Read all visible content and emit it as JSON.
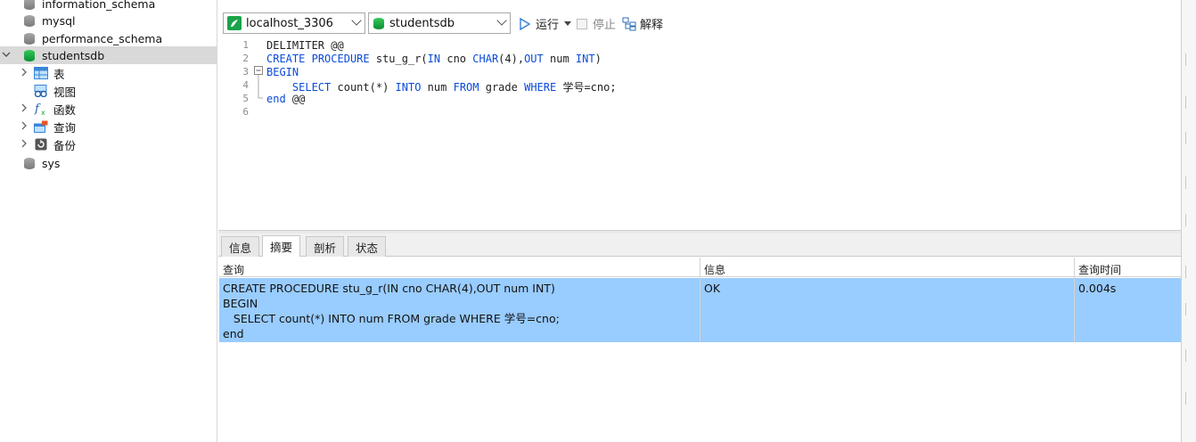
{
  "sidebar": {
    "items": [
      {
        "label": "information_schema"
      },
      {
        "label": "mysql"
      },
      {
        "label": "performance_schema"
      },
      {
        "label": "studentsdb"
      },
      {
        "label": "sys"
      }
    ],
    "children": [
      {
        "label": "表"
      },
      {
        "label": "视图"
      },
      {
        "label": "函数"
      },
      {
        "label": "查询"
      },
      {
        "label": "备份"
      }
    ]
  },
  "toolbar": {
    "connection": "localhost_3306",
    "database": "studentsdb",
    "run_label": "运行",
    "stop_label": "停止",
    "explain_label": "解释"
  },
  "editor": {
    "line_numbers": [
      "1",
      "2",
      "3",
      "4",
      "5",
      "6"
    ],
    "lines": [
      "DELIMITER @@",
      "CREATE PROCEDURE stu_g_r(IN cno CHAR(4),OUT num INT)",
      "BEGIN",
      "    SELECT count(*) INTO num FROM grade WHERE 学号=cno;",
      "end @@",
      ""
    ]
  },
  "result_tabs": [
    {
      "label": "信息"
    },
    {
      "label": "摘要"
    },
    {
      "label": "剖析"
    },
    {
      "label": "状态"
    }
  ],
  "result_grid": {
    "headers": [
      "查询",
      "信息",
      "查询时间"
    ],
    "row": {
      "query": "CREATE PROCEDURE stu_g_r(IN cno CHAR(4),OUT num INT)\nBEGIN\n   SELECT count(*) INTO num FROM grade WHERE 学号=cno;\nend",
      "info": "OK",
      "time": "0.004s"
    }
  },
  "colors": {
    "selected_row": "#99ccff",
    "keyword": "#0b4bd8",
    "db_green": "#16a34a"
  }
}
